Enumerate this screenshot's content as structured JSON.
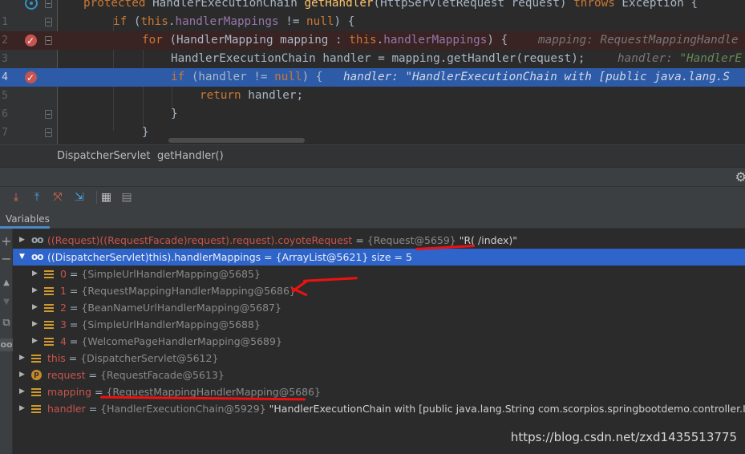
{
  "editor": {
    "lines": [
      {
        "num": "",
        "tokens": [
          [
            "kw",
            "protected "
          ],
          [
            "",
            "HandlerExecutionChain "
          ],
          [
            "fn",
            "getHandler"
          ],
          [
            "",
            "(HttpServletRequest request) "
          ],
          [
            "kw",
            "throws "
          ],
          [
            "",
            "Exception {"
          ]
        ],
        "hint": ""
      },
      {
        "num": "1",
        "tokens": [
          [
            "kw",
            "if "
          ],
          [
            "",
            "("
          ],
          [
            "kw",
            "this"
          ],
          [
            "",
            "."
          ],
          [
            "fld",
            "handlerMappings"
          ],
          [
            "",
            " != "
          ],
          [
            "kw",
            "null"
          ],
          [
            "",
            ") {"
          ]
        ],
        "hint": ""
      },
      {
        "num": "2",
        "tokens": [
          [
            "kw",
            "for "
          ],
          [
            "",
            "(HandlerMapping mapping : "
          ],
          [
            "kw",
            "this"
          ],
          [
            "",
            "."
          ],
          [
            "fld",
            "handlerMappings"
          ],
          [
            "",
            ") {"
          ]
        ],
        "hint": "mapping: RequestMappingHandle"
      },
      {
        "num": "3",
        "tokens": [
          [
            "",
            "HandlerExecutionChain handler = mapping.getHandler(request);"
          ]
        ],
        "hint": "handler: \"HandlerE"
      },
      {
        "num": "4",
        "tokens": [
          [
            "kw",
            "if "
          ],
          [
            "",
            "(handler != "
          ],
          [
            "kw",
            "null"
          ],
          [
            "",
            ") {"
          ]
        ],
        "hint": "handler: \"HandlerExecutionChain with [public java.lang.S"
      },
      {
        "num": "5",
        "tokens": [
          [
            "kw",
            "return "
          ],
          [
            "",
            "handler;"
          ]
        ],
        "hint": ""
      },
      {
        "num": "6",
        "tokens": [
          [
            "",
            "}"
          ]
        ],
        "hint": ""
      },
      {
        "num": "7",
        "tokens": [
          [
            "",
            "}"
          ]
        ],
        "hint": ""
      }
    ]
  },
  "breadcrumbs": [
    "DispatcherServlet",
    "getHandler()"
  ],
  "debug": {
    "toolbar_icons": [
      "step-over-icon",
      "step-out-icon",
      "drop-frame-icon",
      "run-to-cursor-icon",
      "evaluate-icon",
      "trace-icon"
    ],
    "tab_label": "Variables"
  },
  "variables": [
    {
      "name": "((Request)((RequestFacade)request).request).coyoteRequest",
      "eq": " = ",
      "value": "{Request@5659}",
      "extra": " \"R( /index)\"",
      "icon": "watch",
      "arrow": "right",
      "indent": 0,
      "selected": false
    },
    {
      "name": "((DispatcherServlet)this).handlerMappings",
      "eq": " = ",
      "value": "{ArrayList@5621}",
      "extra": "  size = 5",
      "icon": "watch",
      "arrow": "down",
      "indent": 0,
      "selected": true
    },
    {
      "name": "0",
      "eq": " = ",
      "value": "{SimpleUrlHandlerMapping@5685}",
      "extra": "",
      "icon": "field",
      "arrow": "right",
      "indent": 1,
      "selected": false
    },
    {
      "name": "1",
      "eq": " = ",
      "value": "{RequestMappingHandlerMapping@5686}",
      "extra": "",
      "icon": "field",
      "arrow": "right",
      "indent": 1,
      "selected": false
    },
    {
      "name": "2",
      "eq": " = ",
      "value": "{BeanNameUrlHandlerMapping@5687}",
      "extra": "",
      "icon": "field",
      "arrow": "right",
      "indent": 1,
      "selected": false
    },
    {
      "name": "3",
      "eq": " = ",
      "value": "{SimpleUrlHandlerMapping@5688}",
      "extra": "",
      "icon": "field",
      "arrow": "right",
      "indent": 1,
      "selected": false
    },
    {
      "name": "4",
      "eq": " = ",
      "value": "{WelcomePageHandlerMapping@5689}",
      "extra": "",
      "icon": "field",
      "arrow": "right",
      "indent": 1,
      "selected": false
    },
    {
      "name": "this",
      "eq": " = ",
      "value": "{DispatcherServlet@5612}",
      "extra": "",
      "icon": "field",
      "arrow": "right",
      "indent": 0,
      "selected": false
    },
    {
      "name": "request",
      "eq": " = ",
      "value": "{RequestFacade@5613}",
      "extra": "",
      "icon": "param",
      "arrow": "right",
      "indent": 0,
      "selected": false
    },
    {
      "name": "mapping",
      "eq": " = ",
      "value": "{RequestMappingHandlerMapping@5686}",
      "extra": "",
      "icon": "field",
      "arrow": "right",
      "indent": 0,
      "selected": false
    },
    {
      "name": "handler",
      "eq": " = ",
      "value": "{HandlerExecutionChain@5929}",
      "extra": " \"HandlerExecutionChain with [public java.lang.String com.scorpios.springbootdemo.controller.IndexContro",
      "icon": "field",
      "arrow": "right",
      "indent": 0,
      "selected": false
    }
  ],
  "watermark": "https://blog.csdn.net/zxd1435513775",
  "colors": {
    "accent": "#2f65ca",
    "current_line": "#2d5ba8",
    "annotation": "#ee1111"
  }
}
